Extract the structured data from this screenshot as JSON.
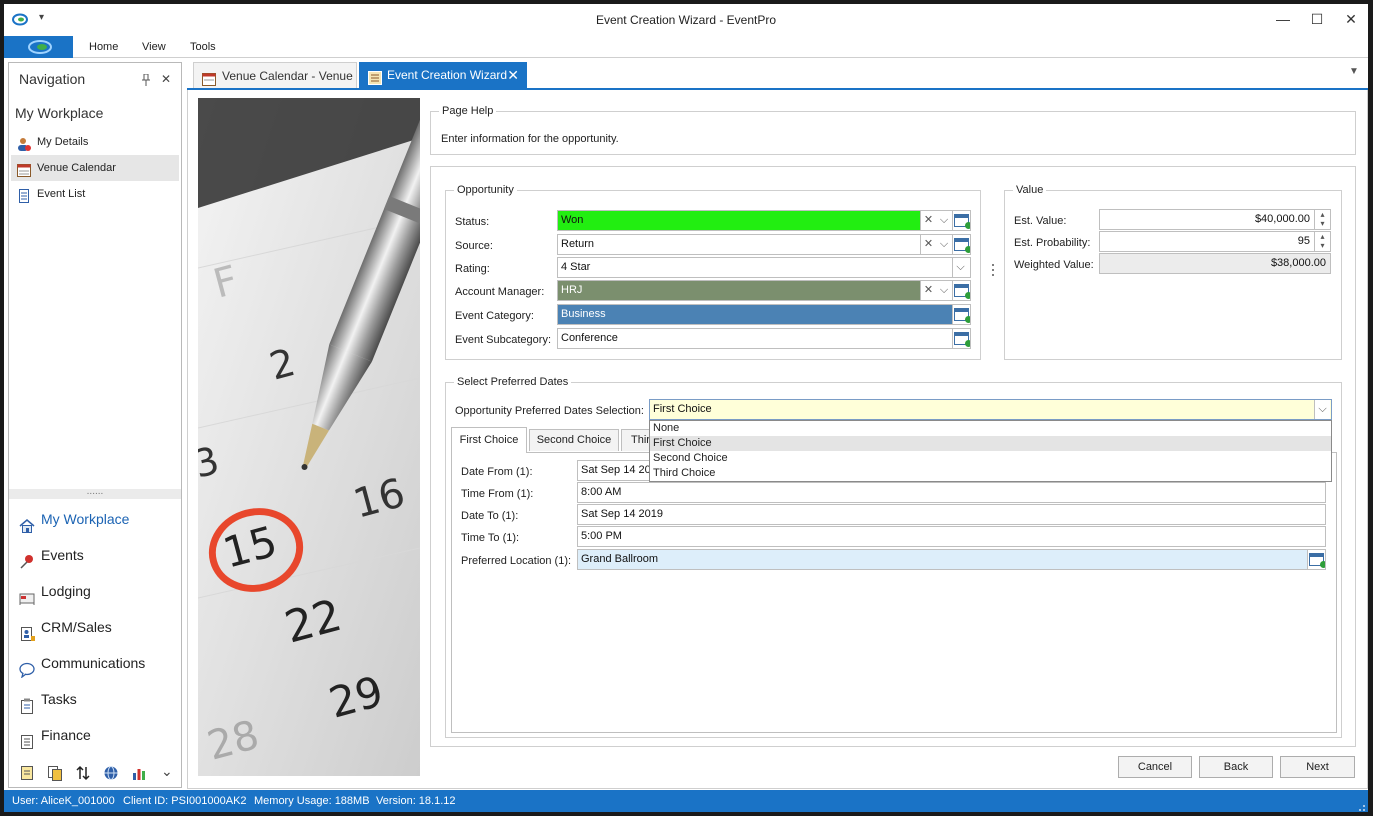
{
  "window": {
    "title": "Event Creation Wizard - EventPro",
    "minimize": "—",
    "maximize": "☐",
    "close": "✕",
    "qat_arrow": "▾"
  },
  "ribbon": {
    "tabs": [
      "Home",
      "View",
      "Tools"
    ]
  },
  "navigation": {
    "title": "Navigation",
    "pin": "📌",
    "close": "✕",
    "section": "My Workplace",
    "items": [
      {
        "label": "My Details",
        "icon": "person-icon"
      },
      {
        "label": "Venue Calendar",
        "icon": "calendar-icon",
        "selected": true
      },
      {
        "label": "Event List",
        "icon": "document-icon"
      }
    ],
    "splitter": "......",
    "modules": [
      {
        "label": "My Workplace",
        "icon": "house-icon",
        "active": true
      },
      {
        "label": "Events",
        "icon": "pushpin-icon"
      },
      {
        "label": "Lodging",
        "icon": "bed-icon"
      },
      {
        "label": "CRM/Sales",
        "icon": "address-book-icon"
      },
      {
        "label": "Communications",
        "icon": "speech-bubble-icon"
      },
      {
        "label": "Tasks",
        "icon": "clipboard-icon"
      },
      {
        "label": "Finance",
        "icon": "ledger-icon"
      }
    ],
    "more": "⌄"
  },
  "doc_tabs": [
    {
      "label": "Venue Calendar - Venue",
      "icon": "calendar-icon",
      "active": false
    },
    {
      "label": "Event Creation Wizard",
      "icon": "wizard-icon",
      "active": true,
      "close": "✕"
    }
  ],
  "page_help": {
    "title": "Page Help",
    "text": "Enter information for the opportunity."
  },
  "opportunity": {
    "title": "Opportunity",
    "status_label": "Status:",
    "status_value": "Won",
    "source_label": "Source:",
    "source_value": "Return",
    "rating_label": "Rating:",
    "rating_value": "4 Star",
    "manager_label": "Account Manager:",
    "manager_value": "HRJ",
    "category_label": "Event Category:",
    "category_value": "Business",
    "subcategory_label": "Event Subcategory:",
    "subcategory_value": "Conference",
    "clear_glyph": "✕",
    "dropdown_glyph": "⌵"
  },
  "value": {
    "title": "Value",
    "est_value_label": "Est. Value:",
    "est_value": "$40,000.00",
    "est_prob_label": "Est. Probability:",
    "est_prob": "95",
    "weighted_label": "Weighted Value:",
    "weighted": "$38,000.00",
    "spin_up": "▴",
    "spin_down": "▾"
  },
  "preferred_dates": {
    "title": "Select Preferred Dates",
    "selection_label": "Opportunity Preferred Dates Selection:",
    "selection_value": "First Choice",
    "options": [
      "None",
      "First Choice",
      "Second Choice",
      "Third Choice"
    ],
    "tabs": [
      "First Choice",
      "Second Choice",
      "Thir"
    ],
    "date_from_label": "Date From (1):",
    "date_from": "Sat Sep 14 20",
    "time_from_label": "Time From (1):",
    "time_from": "8:00 AM",
    "date_to_label": "Date To (1):",
    "date_to": "Sat Sep 14 2019",
    "time_to_label": "Time To (1):",
    "time_to": "5:00 PM",
    "location_label": "Preferred Location (1):",
    "location": "Grand Ballroom"
  },
  "buttons": {
    "cancel": "Cancel",
    "back": "Back",
    "next": "Next"
  },
  "status_bar": {
    "user": "User: AliceK_001000",
    "client": "Client ID: PSI001000AK2",
    "memory": "Memory Usage: 188MB",
    "version": "Version: 18.1.12"
  },
  "photo": {
    "numbers": [
      "2",
      "3",
      "15",
      "16",
      "22",
      "29",
      "28",
      "F"
    ]
  },
  "colors": {
    "accent": "#1a73c6",
    "status_won": "#22ee11",
    "manager": "#7b8f6e",
    "category": "#4b82b4",
    "selection_bg": "#ffffd9",
    "location_bg": "#ddeefa",
    "weighted_bg": "#ececec"
  }
}
